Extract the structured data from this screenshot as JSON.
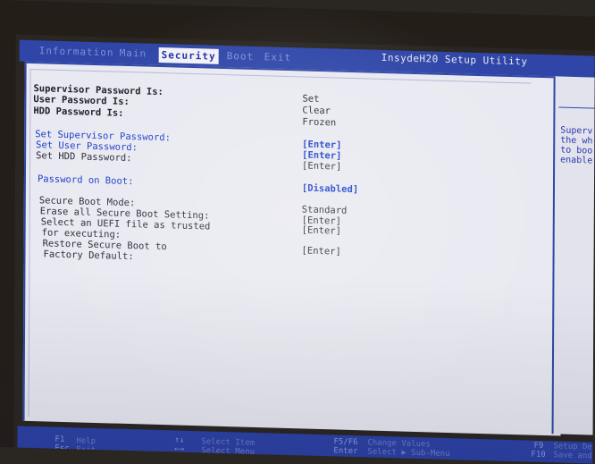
{
  "menubar": {
    "tabs": [
      {
        "label": "Information"
      },
      {
        "label": "Main"
      },
      {
        "label": "Security"
      },
      {
        "label": "Boot"
      },
      {
        "label": "Exit"
      }
    ],
    "utility_title": "InsydeH20 Setup Utility"
  },
  "status": {
    "supervisor_password_label": "Supervisor Password Is:",
    "supervisor_password_value": "Set",
    "user_password_label": "User Password Is:",
    "user_password_value": "Clear",
    "hdd_password_label": "HDD Password Is:",
    "hdd_password_value": "Frozen"
  },
  "items": {
    "set_supervisor_label": "Set Supervisor Password:",
    "set_supervisor_value": "[Enter]",
    "set_user_label": "Set User Password:",
    "set_user_value": "[Enter]",
    "set_hdd_label": "Set HDD Password:",
    "set_hdd_value": "[Enter]",
    "password_on_boot_label": "Password on Boot:",
    "password_on_boot_value": "[Disabled]",
    "secure_boot_mode_label": "Secure Boot Mode:",
    "secure_boot_mode_value": "Standard",
    "erase_secure_boot_label": "Erase all Secure Boot Setting:",
    "erase_secure_boot_value": "[Enter]",
    "select_uefi_label_1": "Select an UEFI file as trusted",
    "select_uefi_label_2": "for executing:",
    "select_uefi_value": "[Enter]",
    "restore_secure_boot_label_1": "Restore Secure Boot to",
    "restore_secure_boot_label_2": "Factory Default:",
    "restore_secure_boot_value": "[Enter]"
  },
  "help": {
    "text": "Superv\nthe wh\nto boo\nenable"
  },
  "bottombar": {
    "f1_key": "F1",
    "f1_text": "Help",
    "esc_key": "Esc",
    "esc_text": "Exit",
    "arrows_ud": "↑↓",
    "arrows_ud_text": "Select Item",
    "arrows_lr": "←→",
    "arrows_lr_text": "Select Menu",
    "f5f6_key": "F5/F6",
    "f5f6_text": "Change Values",
    "enter_key": "Enter",
    "enter_text": "Select ▶ Sub-Menu",
    "f9_key": "F9",
    "f9_text": "Setup De",
    "f10_key": "F10",
    "f10_text": "Save and"
  }
}
